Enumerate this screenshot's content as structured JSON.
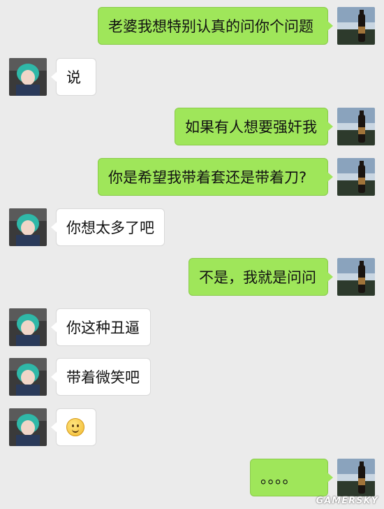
{
  "messages": [
    {
      "from": "me",
      "text": "老婆我想特别认真的问你个问题"
    },
    {
      "from": "them",
      "text": "说"
    },
    {
      "from": "me",
      "text": "如果有人想要强奸我"
    },
    {
      "from": "me",
      "text": "你是希望我带着套还是带着刀?"
    },
    {
      "from": "them",
      "text": "你想太多了吧"
    },
    {
      "from": "me",
      "text": "不是，我就是问问"
    },
    {
      "from": "them",
      "text": "你这种丑逼"
    },
    {
      "from": "them",
      "text": "带着微笑吧"
    },
    {
      "from": "them",
      "emoji": "smile-emoji"
    },
    {
      "from": "me",
      "text": "。。。。"
    }
  ],
  "watermark": "GAMERSKY",
  "colors": {
    "background": "#ebebeb",
    "my_bubble": "#9fe65a",
    "their_bubble": "#ffffff"
  }
}
